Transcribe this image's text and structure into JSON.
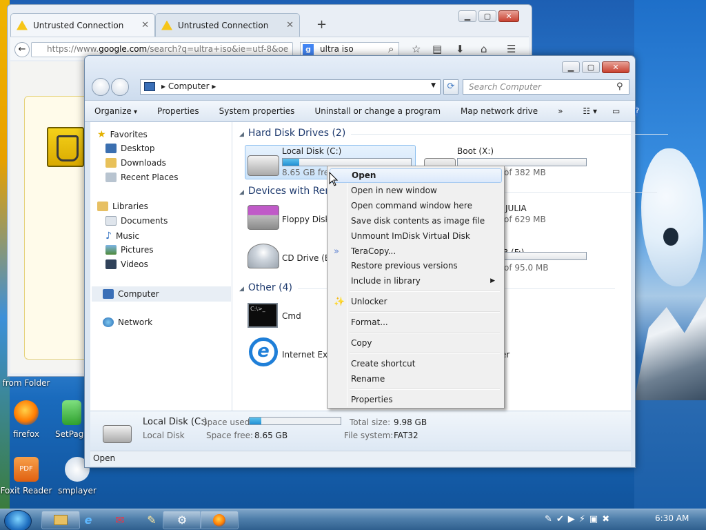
{
  "browser": {
    "tabs": [
      {
        "label": "Untrusted Connection"
      },
      {
        "label": "Untrusted Connection"
      }
    ],
    "new_tab": "+",
    "url_prefix": "https://www.",
    "url_domain": "google.com",
    "url_rest": "/search?q=ultra+iso&ie=utf-8&oe",
    "search_value": "ultra iso"
  },
  "explorer": {
    "breadcrumb": "Computer",
    "search_placeholder": "Search Computer",
    "toolbar": [
      "Organize",
      "Properties",
      "System properties",
      "Uninstall or change a program",
      "Map network drive",
      "»"
    ],
    "nav": {
      "favorites": "Favorites",
      "desktop": "Desktop",
      "downloads": "Downloads",
      "recent": "Recent Places",
      "libraries": "Libraries",
      "documents": "Documents",
      "music": "Music",
      "pictures": "Pictures",
      "videos": "Videos",
      "computer": "Computer",
      "network": "Network"
    },
    "groups": {
      "hdd": "Hard Disk Drives (2)",
      "removable": "Devices with Rem",
      "other": "Other (4)"
    },
    "drives": {
      "c_name": "Local Disk (C:)",
      "c_free": "8.65 GB free",
      "c_fill": 0.13,
      "boot_name": "Boot (X:)",
      "boot_sub": "of 382 MB",
      "boot_fill": 0.0,
      "floppy": "Floppy Disk",
      "julia_name": "JULIA",
      "julia_sub": "of 629 MB",
      "cd": "CD Drive (E:)",
      "f_name": "B (F:)",
      "f_sub": "of 95.0 MB",
      "f_fill": 0.0,
      "cmd": "Cmd",
      "ie": "Internet Expl",
      "other_right": "er"
    },
    "details": {
      "name": "Local Disk (C:)",
      "type": "Local Disk",
      "used_label": "Space used:",
      "used_fill": 0.13,
      "free_label": "Space free:",
      "free_value": "8.65 GB",
      "total_label": "Total size:",
      "total_value": "9.98 GB",
      "fs_label": "File system:",
      "fs_value": "FAT32"
    },
    "status": "Open"
  },
  "context_menu": [
    {
      "label": "Open",
      "bold": true
    },
    {
      "label": "Open in new window"
    },
    {
      "label": "Open command window here"
    },
    {
      "label": "Save disk contents as image file"
    },
    {
      "label": "Unmount ImDisk Virtual Disk"
    },
    {
      "label": "TeraCopy..."
    },
    {
      "label": "Restore previous versions"
    },
    {
      "label": "Include in library"
    },
    {
      "label": "Unlocker"
    },
    {
      "label": "Format..."
    },
    {
      "label": "Copy"
    },
    {
      "label": "Create shortcut"
    },
    {
      "label": "Rename"
    },
    {
      "label": "Properties"
    }
  ],
  "desktop": {
    "firefox": "firefox",
    "setpage": "SetPage",
    "foxit": "Foxit Reader",
    "smplayer": "smplayer",
    "folder_partial": "from Folder"
  },
  "taskbar": {
    "clock": "6:30 AM"
  },
  "colors": {
    "accent": "#1f8fd4",
    "selection": "#cbe3fa"
  }
}
